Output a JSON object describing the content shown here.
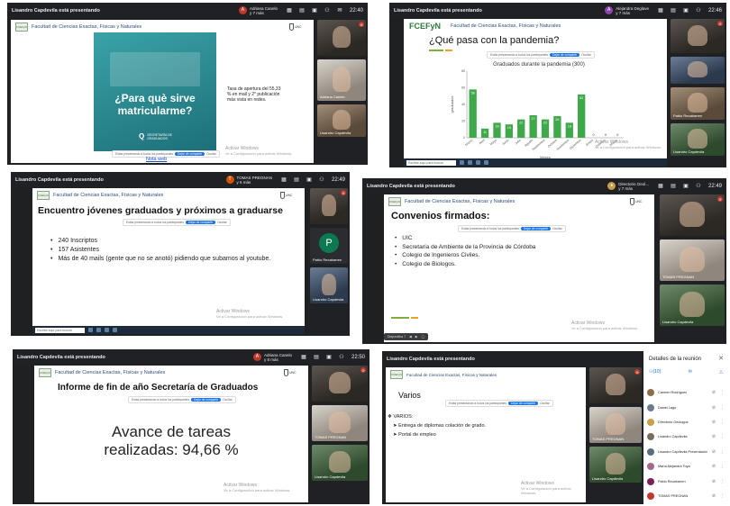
{
  "common": {
    "presenter": "Lisandro Capdevila está presentando",
    "faculty": "Facultad de Ciencias Exactas, Físicas y Naturales",
    "fcefyn_logo": "FCEFyN",
    "unc_logo": "UNC",
    "share_notice": "Estás presentando a todos los participantes",
    "stop_sharing": "Dejar de compartir",
    "share_hide": "Ocultar",
    "activate_windows": "Activar Windows",
    "activate_hint": "Ve a Configuración para activar Windows.",
    "taskbar_search": "Escribe aquí para buscar",
    "colors": {
      "meet_dark": "#202124",
      "accent_blue": "#1a73e8",
      "chart_green": "#3fa84a",
      "rule_green": "#7fae3c",
      "mic_red": "#c0392b"
    }
  },
  "s1": {
    "viewer": "Adriana Canelo",
    "viewer_sub": "y 7 más",
    "viewer_initial": "A",
    "clock": "22:40",
    "poster_line1": "¿Para què sirve",
    "poster_line2": "matricularme?",
    "poster_badge": "SECRETARÍA DE GRADUADOS",
    "side_note": "Tasa de apertura del 55,33 % en mail y 2° publicación más vista en redes.",
    "link": "Nota web",
    "tiles": [
      {
        "name": ""
      },
      {
        "name": "Adriana Canelo"
      },
      {
        "name": "Lisandro Capdevila"
      }
    ]
  },
  "s2": {
    "viewer": "Alejandra Deglave",
    "viewer_sub": "y 7 más",
    "viewer_initial": "A",
    "clock": "22:46",
    "logo": "FCEFyN",
    "title": "¿Qué pasa con la pandemia?",
    "tiles": [
      {
        "name": ""
      },
      {
        "name": ""
      },
      {
        "name": "Pablo Recabarren"
      },
      {
        "name": "Lisandro Capdevila"
      }
    ]
  },
  "chart_data": {
    "type": "bar",
    "title": "Graduados durante la pandemia (300)",
    "ylabel": "graduados",
    "xlabel": "Meses",
    "categories": [
      "Marzo",
      "Abril",
      "Mayo",
      "Junio",
      "Julio",
      "Agosto",
      "Septiembre",
      "Octubre",
      "Noviembre",
      "Diciembre",
      "Enero",
      "Febrero",
      "Marzo"
    ],
    "values": [
      58,
      11,
      18,
      16,
      22,
      27,
      22,
      26,
      18,
      52,
      0,
      0,
      0
    ],
    "ylim": [
      0,
      80
    ],
    "yticks": [
      0,
      20,
      40,
      60,
      80
    ],
    "grid": false,
    "color": "#3fa84a"
  },
  "s3": {
    "viewer": "TOMAS PREGNAN",
    "viewer_sub": "y 6 más",
    "viewer_initial": "T",
    "clock": "22:49",
    "title": "Encuentro jóvenes graduados y próximos a graduarse",
    "bullets": [
      "240 Inscriptos",
      "157 Asistentes",
      "Más de 40 mails (gente que no se anotó) pidiendo que subamos al youtube."
    ],
    "tiles": [
      {
        "name": ""
      },
      {
        "name": "Pablo Recabarren",
        "initial": "P"
      },
      {
        "name": "Lisandro Capdevila"
      }
    ]
  },
  "s4": {
    "viewer": "Directorio Geol...",
    "viewer_sub": "y 7 más",
    "clock": "22:49",
    "title": "Convenios firmados:",
    "bullets": [
      "UIC",
      "Secretaría de Ambiente de la Provincia de Córdoba",
      "Colegio de Ingenieros Civiles.",
      "Colegio de Biologos."
    ],
    "dock_label": "Diapositiva 7",
    "tiles": [
      {
        "name": ""
      },
      {
        "name": "TOMAS PREGNAN"
      },
      {
        "name": "Lisandro Capdevila"
      }
    ]
  },
  "s5": {
    "viewer": "Adriana Canelo",
    "viewer_sub": "y 8 más",
    "viewer_initial": "A",
    "clock": "22:50",
    "title": "Informe de fin de año Secretaría de Graduados",
    "big1": "Avance de tareas",
    "big2": "realizadas: 94,66 %",
    "tiles": [
      {
        "name": ""
      },
      {
        "name": "TOMAS PREGNAN"
      },
      {
        "name": "Lisandro Capdevila"
      }
    ]
  },
  "s6": {
    "title": "Varios",
    "items": [
      "VARIOS:",
      "Entrega de diplomas colación de grado.",
      "Portal de empleo"
    ],
    "details_title": "Detalles de la reunión",
    "participants_count": "(10)",
    "tiles": [
      {
        "name": ""
      },
      {
        "name": "TOMAS PREGNAN"
      },
      {
        "name": "Lisandro Capdevila"
      }
    ],
    "participants": [
      {
        "name": "Carmen Rodríguez",
        "color": "#8e6c4a"
      },
      {
        "name": "Daniel Lago",
        "color": "#6a7c8e"
      },
      {
        "name": "Directorio Geólogos",
        "color": "#c9a04a"
      },
      {
        "name": "Lisandro Capdevila",
        "color": "#7a6b5c"
      },
      {
        "name": "Lisandro Capdevila Presentación",
        "color": "#5c6e7a"
      },
      {
        "name": "María Alejandra Toya",
        "color": "#a06a8a"
      },
      {
        "name": "Pablo Recabarren",
        "color": "#7a1f5c"
      },
      {
        "name": "TOMAS PREGNAN",
        "color": "#c0392b"
      },
      {
        "name": "Victor Carranza",
        "color": "#d35400"
      }
    ]
  }
}
